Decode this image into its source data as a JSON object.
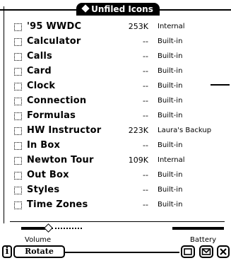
{
  "folder": {
    "title": "Unfiled Icons"
  },
  "packages": [
    {
      "name": "'95 WWDC",
      "size": "253K",
      "location": "Internal"
    },
    {
      "name": "Calculator",
      "size": "--",
      "location": "Built-in"
    },
    {
      "name": "Calls",
      "size": "--",
      "location": "Built-in"
    },
    {
      "name": "Card",
      "size": "--",
      "location": "Built-in"
    },
    {
      "name": "Clock",
      "size": "--",
      "location": "Built-in"
    },
    {
      "name": "Connection",
      "size": "--",
      "location": "Built-in"
    },
    {
      "name": "Formulas",
      "size": "--",
      "location": "Built-in"
    },
    {
      "name": "HW Instructor",
      "size": "223K",
      "location": "Laura's Backup"
    },
    {
      "name": "In Box",
      "size": "--",
      "location": "Built-in"
    },
    {
      "name": "Newton Tour",
      "size": "109K",
      "location": "Internal"
    },
    {
      "name": "Out Box",
      "size": "--",
      "location": "Built-in"
    },
    {
      "name": "Styles",
      "size": "--",
      "location": "Built-in"
    },
    {
      "name": "Time Zones",
      "size": "--",
      "location": "Built-in"
    }
  ],
  "status": {
    "volume_label": "Volume",
    "volume_level": 0.4,
    "battery_label": "Battery",
    "battery_level": 1.0
  },
  "buttons": {
    "info_label": "i",
    "rotate_label": "Rotate"
  },
  "icons": {
    "folder_diamond": "diamond-icon",
    "info": "info-icon",
    "overview": "overview-icon",
    "routing": "envelope-icon",
    "close": "close-icon"
  }
}
